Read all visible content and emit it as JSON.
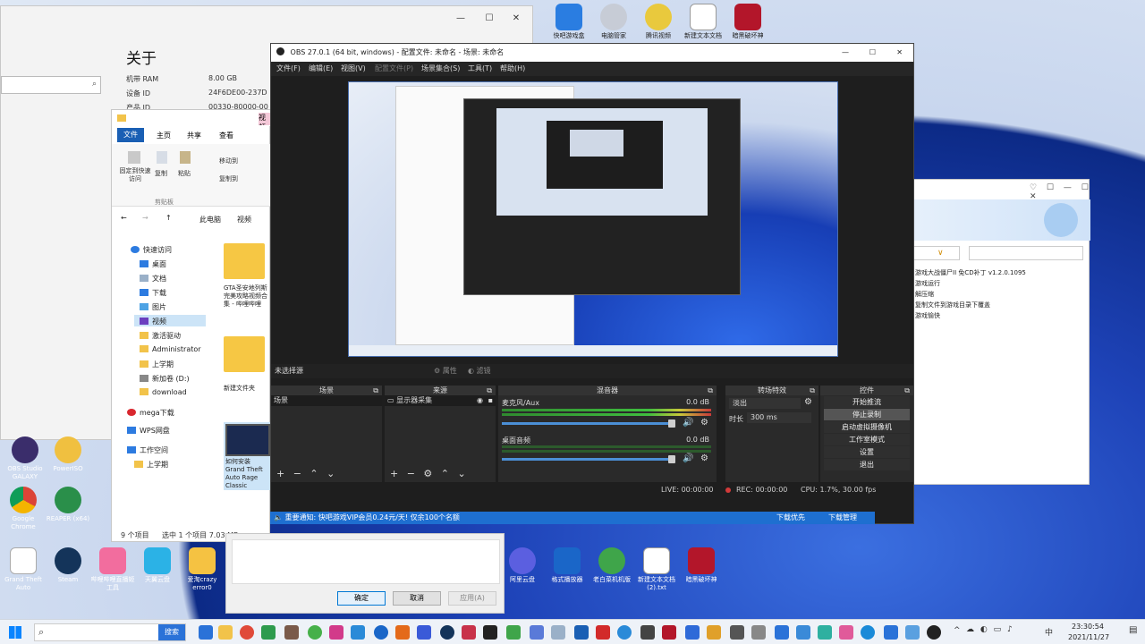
{
  "settings_window": {
    "title": "关于",
    "rows": [
      {
        "label": "机带 RAM",
        "value": "8.00 GB"
      },
      {
        "label": "设备 ID",
        "value": "24F6DE00-237D"
      },
      {
        "label": "产品 ID",
        "value": "00330-80000-00"
      }
    ]
  },
  "explorer": {
    "ribbon_tabs": [
      "文件",
      "主页",
      "共享",
      "查看"
    ],
    "ribbon_extra_tab": "视频",
    "ribbon_pin_label": "固定到快速访问",
    "ribbon_copy": "复制",
    "ribbon_paste": "粘贴",
    "ribbon_move": "移动到",
    "ribbon_copyto": "复制到",
    "ribbon_group": "剪贴板",
    "breadcrumb": [
      "此电脑",
      "视频"
    ],
    "nav": {
      "quick_access": "快速访问",
      "items": [
        "桌面",
        "文档",
        "下载",
        "图片",
        "视频",
        "激活驱动",
        "Administrator",
        "上学期",
        "新加卷 (D:)",
        "download"
      ],
      "mega": "mega下载",
      "wps": "WPS网盘",
      "workspace": "工作空间",
      "last_term": "上学期"
    },
    "files": [
      {
        "name": "GTA圣安地列斯 完美攻略视频合集 - 哔哩哔哩"
      },
      {
        "name": "新建文件夹"
      },
      {
        "name": "如何安装 Grand Theft Auto Rage Classic PC.mkv"
      }
    ],
    "status_count": "9 个项目",
    "status_selected": "选中 1 个项目  7.03 MB"
  },
  "dialog": {
    "ok": "确定",
    "cancel": "取消",
    "apply": "应用(A)"
  },
  "right_window": {
    "dropdown": "∨",
    "lines": [
      "游戏大战僵尸II 免CD补丁 v1.2.0.1095",
      "游戏运行",
      "解压缩",
      "复制文件到游戏目录下覆盖",
      "游戏愉快"
    ]
  },
  "obs": {
    "title": "OBS 27.0.1 (64 bit, windows) - 配置文件: 未命名 - 场景: 未命名",
    "menu": [
      "文件(F)",
      "编辑(E)",
      "视图(V)",
      "配置文件(P)",
      "场景集合(S)",
      "工具(T)",
      "帮助(H)"
    ],
    "no_source": "未选择源",
    "props_btn": "属性",
    "filters_btn": "滤镜",
    "docks": {
      "scenes": "场景",
      "sources": "来源",
      "mixer": "混音器",
      "transitions": "转场特效",
      "controls": "控件"
    },
    "scene_item": "场景",
    "source_item": "显示器采集",
    "mixer_tracks": [
      {
        "name": "麦克风/Aux",
        "db": "0.0 dB"
      },
      {
        "name": "桌面音频",
        "db": "0.0 dB"
      }
    ],
    "transition": "淡出",
    "duration_label": "时长",
    "duration_value": "300 ms",
    "controls": [
      "开始推流",
      "停止录制",
      "启动虚拟摄像机",
      "工作室模式",
      "设置",
      "退出"
    ],
    "status": {
      "live": "LIVE: 00:00:00",
      "rec": "REC: 00:00:00",
      "cpu": "CPU: 1.7%, 30.00 fps"
    }
  },
  "notify_bar": {
    "text": "重要通知: 快吧游戏VIP会员0.24元/天! 仅余100个名额",
    "btn1": "下载优先",
    "btn2": "下载管理"
  },
  "desktop_top_icons": [
    "快吧游戏盒",
    "电脑管家",
    "腾讯视频",
    "新建文本文档",
    "暗黑破坏神"
  ],
  "desktop_left_icons": [
    {
      "label": "Google Chrome"
    },
    {
      "label": "REAPER (x64)"
    },
    {
      "label": "OBS Studio GALAXY"
    },
    {
      "label": "PowerISO"
    },
    {
      "label": "Grand Theft Auto"
    },
    {
      "label": "Steam"
    },
    {
      "label": "哔哩哔哩直播姬工具"
    },
    {
      "label": "天翼云盘"
    },
    {
      "label": "爱淘crazy error0"
    }
  ],
  "desktop_bottom_icons": [
    "阿里云盘",
    "格式播放器",
    "老白菜机机版",
    "新建文本文档 (2).txt",
    "暗黑破坏神"
  ],
  "taskbar": {
    "search_button": "搜索",
    "time": "23:30:54",
    "date": "2021/11/27",
    "tray_lang": "中"
  },
  "colors": {
    "obs_bg": "#1e1e1e",
    "obs_panel": "#2a2a2a",
    "accent_blue": "#1e6fd0",
    "rec_red": "#d23a3a",
    "ribbon_blue": "#1a5fb4"
  }
}
